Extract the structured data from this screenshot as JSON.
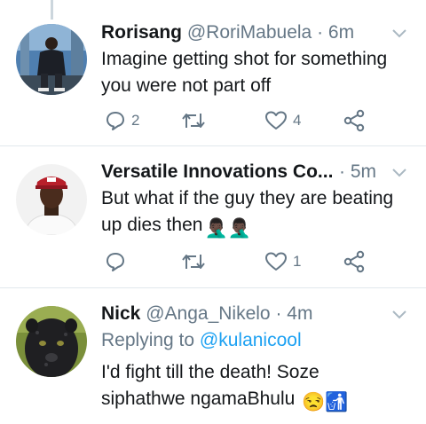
{
  "tweets": [
    {
      "name": "Rorisang",
      "handle": "@RoriMabuela",
      "time": "· 6m",
      "text_line1": "Imagine getting shot for something",
      "text_line2": "you were not part off",
      "replies": "2",
      "retweets": "",
      "likes": "4"
    },
    {
      "name": "Versatile Innovations Co...",
      "handle": "",
      "time": "· 5m",
      "text_line1": "But what if the guy they are beating",
      "text_line2": "up dies then",
      "emoji": "🤦🏿‍♂️🤦🏿‍♂️",
      "replies": "",
      "retweets": "",
      "likes": "1"
    },
    {
      "name": "Nick",
      "handle": "@Anga_Nikelo",
      "time": "· 4m",
      "replying_label": "Replying to",
      "replying_handle": "@kulanicool",
      "text_line1": "I'd fight till the death! Soze",
      "text_line2": "siphathwe ngamaBhulu",
      "emoji": "😒🚮"
    }
  ],
  "icons": {
    "reply": "reply-icon",
    "retweet": "retweet-icon",
    "like": "heart-icon",
    "share": "share-icon",
    "menu": "chevron-down-icon"
  },
  "colors": {
    "text": "#14171a",
    "muted": "#657786",
    "link": "#1da1f2",
    "divider": "#e1e8ed"
  }
}
